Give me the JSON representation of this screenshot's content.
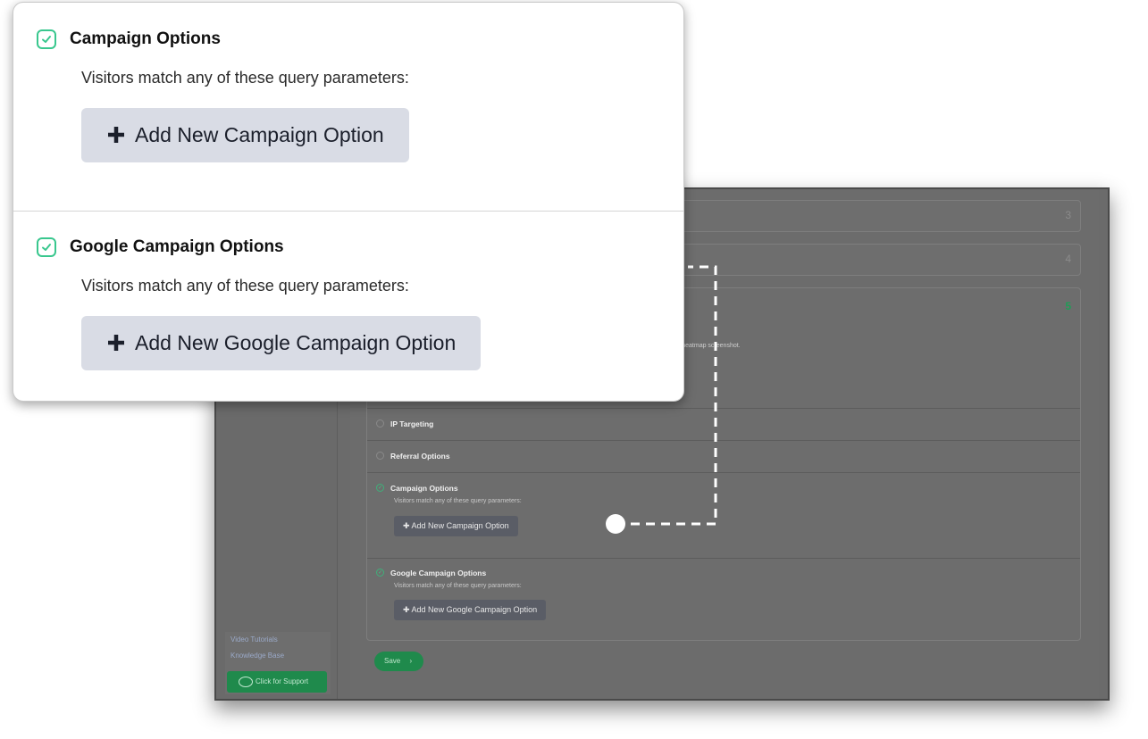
{
  "zoom": {
    "sections": [
      {
        "title": "Campaign Options",
        "subtitle": "Visitors match any of these query parameters:",
        "button": "Add New Campaign Option",
        "checked": true
      },
      {
        "title": "Google Campaign Options",
        "subtitle": "Visitors match any of these query parameters:",
        "button": "Add New Google Campaign Option",
        "checked": true
      }
    ]
  },
  "screen": {
    "accordions": [
      {
        "number": "3"
      },
      {
        "number": "4"
      },
      {
        "number": "5"
      }
    ],
    "panel_note": "apturing heatmap screenshot.",
    "rows": [
      {
        "title": "IP Targeting",
        "checked": false
      },
      {
        "title": "Referral Options",
        "checked": false
      },
      {
        "title": "Campaign Options",
        "checked": true,
        "subtitle": "Visitors match any of these query parameters:",
        "button": "Add New Campaign Option"
      },
      {
        "title": "Google Campaign Options",
        "checked": true,
        "subtitle": "Visitors match any of these query parameters:",
        "button": "Add New Google Campaign Option"
      }
    ],
    "save_label": "Save",
    "sidebar": {
      "links": [
        "Video Tutorials",
        "Knowledge Base"
      ],
      "support_label": "Click for Support"
    }
  },
  "colors": {
    "accent": "#39c78e",
    "button_bg": "#d9dce5",
    "save_green": "#1f8a4c"
  }
}
